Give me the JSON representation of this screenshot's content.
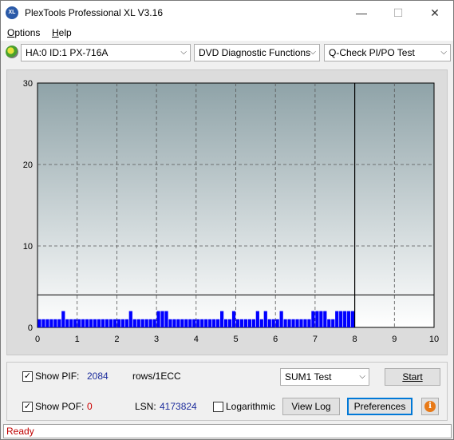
{
  "window": {
    "title": "PlexTools Professional XL V3.16",
    "icon_text": "XL",
    "minimize": "—",
    "maximize": "☐",
    "close": "✕"
  },
  "menu": {
    "options": {
      "u": "O",
      "rest": "ptions"
    },
    "help": {
      "u": "H",
      "rest": "elp"
    }
  },
  "toolbar": {
    "drive": "HA:0 ID:1  PX-716A",
    "function": "DVD Diagnostic Functions",
    "test": "Q-Check PI/PO Test"
  },
  "chart_data": {
    "type": "bar",
    "x_ticks": [
      0,
      1,
      2,
      3,
      4,
      5,
      6,
      7,
      8,
      9,
      10
    ],
    "y_ticks": [
      0,
      10,
      20,
      30
    ],
    "xlim": [
      0,
      10
    ],
    "ylim": [
      0,
      30
    ],
    "grid": true,
    "threshold_line": 4,
    "progress_marker_x": 8,
    "colors": {
      "bars": "#0000ff",
      "plot_top": "#8fa3a8",
      "plot_bottom": "#ffffff"
    },
    "series": [
      {
        "x": [
          0.05,
          0.15,
          0.25,
          0.35,
          0.45,
          0.55,
          0.65,
          0.75,
          0.85,
          0.95,
          1.05,
          1.15,
          1.25,
          1.35,
          1.45,
          1.55,
          1.65,
          1.75,
          1.85,
          1.95,
          2.05,
          2.15,
          2.25,
          2.35,
          2.45,
          2.55,
          2.65,
          2.75,
          2.85,
          2.95,
          3.05,
          3.15,
          3.25,
          3.35,
          3.45,
          3.55,
          3.65,
          3.75,
          3.85,
          3.95,
          4.05,
          4.15,
          4.25,
          4.35,
          4.45,
          4.55,
          4.65,
          4.75,
          4.85,
          4.95,
          5.05,
          5.15,
          5.25,
          5.35,
          5.45,
          5.55,
          5.65,
          5.75,
          5.85,
          5.95,
          6.05,
          6.15,
          6.25,
          6.35,
          6.45,
          6.55,
          6.65,
          6.75,
          6.85,
          6.95,
          7.05,
          7.15,
          7.25,
          7.35,
          7.45,
          7.55,
          7.65,
          7.75,
          7.85,
          7.95
        ],
        "values": [
          1,
          1,
          1,
          1,
          1,
          1,
          2,
          1,
          1,
          1,
          1,
          1,
          1,
          1,
          1,
          1,
          1,
          1,
          1,
          1,
          1,
          1,
          1,
          2,
          1,
          1,
          1,
          1,
          1,
          1,
          2,
          2,
          2,
          1,
          1,
          1,
          1,
          1,
          1,
          1,
          1,
          1,
          1,
          1,
          1,
          1,
          2,
          1,
          1,
          2,
          1,
          1,
          1,
          1,
          1,
          2,
          1,
          2,
          1,
          1,
          1,
          2,
          1,
          1,
          1,
          1,
          1,
          1,
          1,
          2,
          2,
          2,
          2,
          1,
          1,
          2,
          2,
          2,
          2,
          2
        ]
      }
    ]
  },
  "controls": {
    "show_pif_label": "Show PIF:",
    "pif_value": "2084",
    "rows_label": "rows/1ECC",
    "show_pof_label": "Show POF:",
    "pof_value": "0",
    "lsn_label": "LSN:",
    "lsn_value": "4173824",
    "logarithmic_label": "Logarithmic",
    "test_select": "SUM1 Test",
    "start": "Start",
    "view_log": "View Log",
    "preferences": "Preferences",
    "info": "i",
    "check_mark": "✓"
  },
  "status": {
    "text": "Ready"
  }
}
